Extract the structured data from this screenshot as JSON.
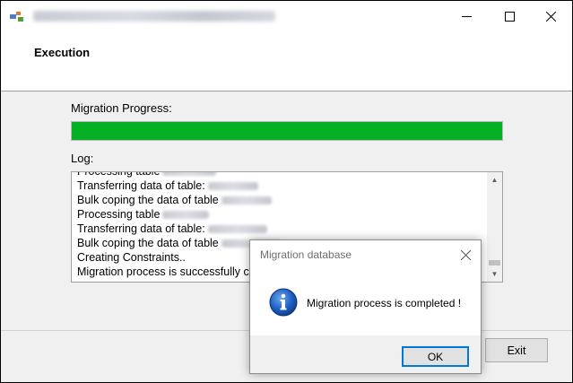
{
  "window": {
    "title": "",
    "icon": "app-icon",
    "controls": [
      "minimize-icon",
      "maximize-icon",
      "close-icon"
    ]
  },
  "header": {
    "title": "Execution"
  },
  "progress": {
    "label": "Migration Progress:",
    "value_percent": 100,
    "color": "#06b025"
  },
  "log": {
    "label": "Log:",
    "lines": [
      "Processing table",
      "Transferring data of table:",
      "Bulk coping the data of table",
      "Processing table",
      "Transferring data of table:",
      "Bulk coping the data of table",
      "Creating Constraints..",
      "Migration process is successfully com"
    ]
  },
  "exit_label": "Exit",
  "dialog": {
    "title": "Migration database",
    "icon": "info-icon",
    "message": "Migration process is completed !",
    "ok_label": "OK"
  }
}
